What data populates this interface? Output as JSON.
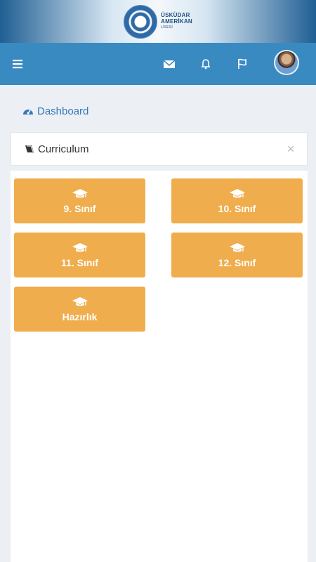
{
  "header": {
    "brand": {
      "line1": "ÜSKÜDAR",
      "line2": "AMERİKAN",
      "line3": "LİSESİ"
    },
    "navbar": {
      "icons": [
        "menu-icon",
        "envelope-icon",
        "bell-icon",
        "flag-icon",
        "avatar"
      ],
      "color": "#3a8ac2"
    }
  },
  "breadcrumb": {
    "icon": "dashboard-icon",
    "label": "Dashboard"
  },
  "panel": {
    "title_icon": "book-icon",
    "title": "Curriculum",
    "close_label": "×"
  },
  "grades": [
    {
      "label": "9. Sınıf",
      "icon": "graduation-cap-icon"
    },
    {
      "label": "10. Sınıf",
      "icon": "graduation-cap-icon"
    },
    {
      "label": "11. Sınıf",
      "icon": "graduation-cap-icon"
    },
    {
      "label": "12. Sınıf",
      "icon": "graduation-cap-icon"
    },
    {
      "label": "Hazırlık",
      "icon": "graduation-cap-icon"
    }
  ],
  "colors": {
    "accent": "#efad4d",
    "background": "#eceff4"
  }
}
